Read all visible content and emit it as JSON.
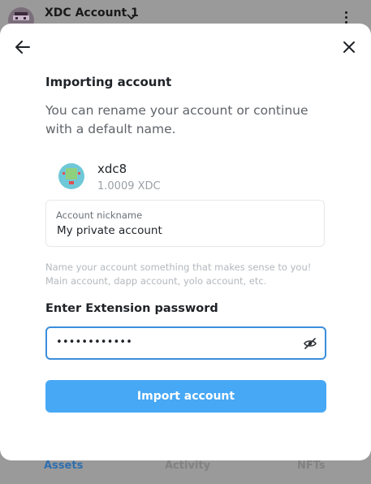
{
  "background": {
    "account_name": "XDC Account 1",
    "tabs": [
      {
        "label": "Assets",
        "active": true
      },
      {
        "label": "Activity",
        "active": false
      },
      {
        "label": "NFTs",
        "active": false
      }
    ]
  },
  "modal": {
    "title": "Importing account",
    "subtitle": "You can rename your account or continue with a default name.",
    "account": {
      "name": "xdc8",
      "balance": "1.0009 XDC"
    },
    "nickname": {
      "label": "Account nickname",
      "value": "My private account"
    },
    "hint": "Name your account something that makes sense to you! Main account, dapp account, yolo account, etc.",
    "password": {
      "label": "Enter Extension password",
      "masked_value": "••••••••••••"
    },
    "import_button": "Import account"
  },
  "colors": {
    "accent": "#47a8f5",
    "focus_border": "#3b8edb",
    "active_tab": "#2f6fb0"
  }
}
